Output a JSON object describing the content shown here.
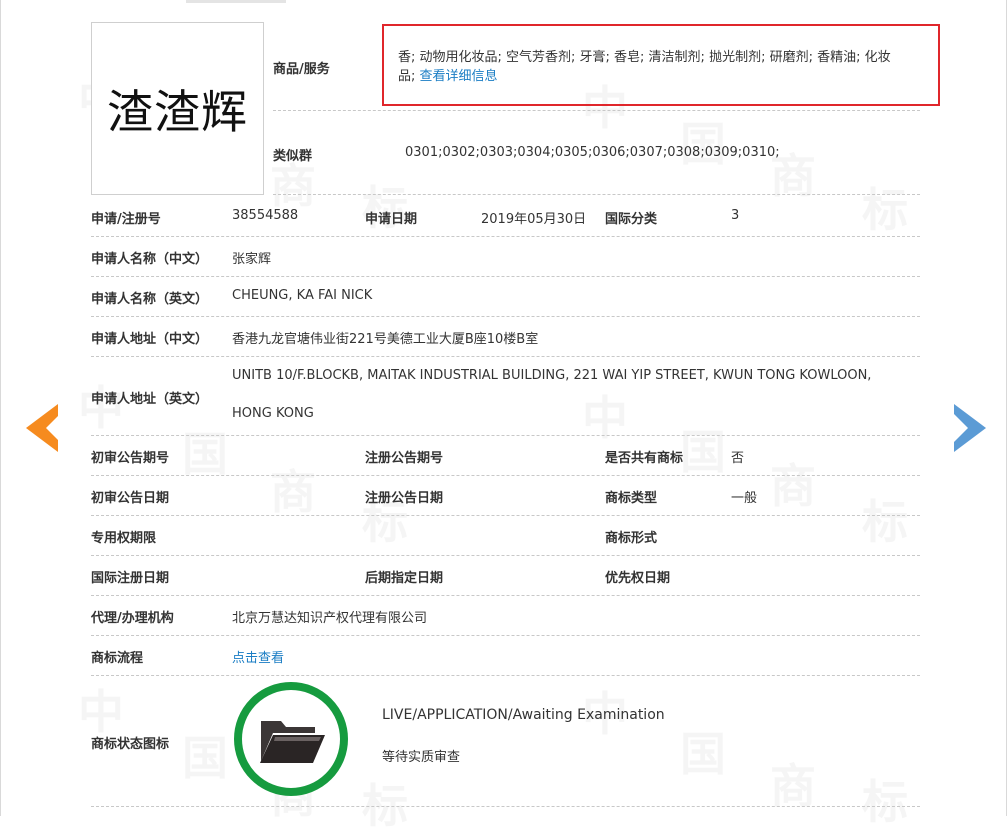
{
  "trademark": {
    "name": "渣渣辉"
  },
  "goods": {
    "label": "商品/服务",
    "line1": "香; 动物用化妆品; 空气芳香剂; 牙膏; 香皂; 清洁制剂; 抛光制剂; 研磨剂; 香精油; 化妆",
    "line2_prefix": "品;",
    "detail_link": "查看详细信息"
  },
  "similar_group": {
    "label": "类似群",
    "value": "0301;0302;0303;0304;0305;0306;0307;0308;0309;0310;"
  },
  "fields": {
    "reg_no": {
      "label": "申请/注册号",
      "value": "38554588"
    },
    "apply_date": {
      "label": "申请日期",
      "value": "2019年05月30日"
    },
    "intl_class": {
      "label": "国际分类",
      "value": "3"
    },
    "applicant_cn": {
      "label": "申请人名称（中文）",
      "value": "张家辉"
    },
    "applicant_en": {
      "label": "申请人名称（英文）",
      "value": "CHEUNG, KA FAI NICK"
    },
    "address_cn": {
      "label": "申请人地址（中文）",
      "value": "香港九龙官塘伟业街221号美德工业大厦B座10楼B室"
    },
    "address_en": {
      "label": "申请人地址（英文）",
      "line1": "UNITB 10/F.BLOCKB, MAITAK INDUSTRIAL BUILDING, 221 WAI YIP STREET, KWUN TONG KOWLOON,",
      "line2": "HONG KONG"
    },
    "prelim_pub_no": {
      "label": "初审公告期号",
      "value": ""
    },
    "reg_pub_no": {
      "label": "注册公告期号",
      "value": ""
    },
    "shared_mark": {
      "label": "是否共有商标",
      "value": "否"
    },
    "prelim_pub_date": {
      "label": "初审公告日期",
      "value": ""
    },
    "reg_pub_date": {
      "label": "注册公告日期",
      "value": ""
    },
    "mark_type": {
      "label": "商标类型",
      "value": "一般"
    },
    "exclusive_period": {
      "label": "专用权期限",
      "value": ""
    },
    "mark_form": {
      "label": "商标形式",
      "value": ""
    },
    "intl_reg_date": {
      "label": "国际注册日期",
      "value": ""
    },
    "later_designation_date": {
      "label": "后期指定日期",
      "value": ""
    },
    "priority_date": {
      "label": "优先权日期",
      "value": ""
    },
    "agent": {
      "label": "代理/办理机构",
      "value": "北京万慧达知识产权代理有限公司"
    },
    "process": {
      "label": "商标流程",
      "link": "点击查看"
    },
    "status": {
      "label": "商标状态图标",
      "en": "LIVE/APPLICATION/Awaiting Examination",
      "cn": "等待实质审查"
    }
  },
  "watermark": {
    "chars": [
      "中",
      "国",
      "商",
      "标"
    ]
  },
  "colors": {
    "link": "#1a7dc4",
    "highlight_border": "#e0262b",
    "prev_arrow": "#f68b1f",
    "next_arrow": "#5b9bd5",
    "status_ring": "#169b3f"
  },
  "icons": {
    "prev": "left-arrow-icon",
    "next": "right-arrow-icon",
    "status": "folder-icon"
  }
}
